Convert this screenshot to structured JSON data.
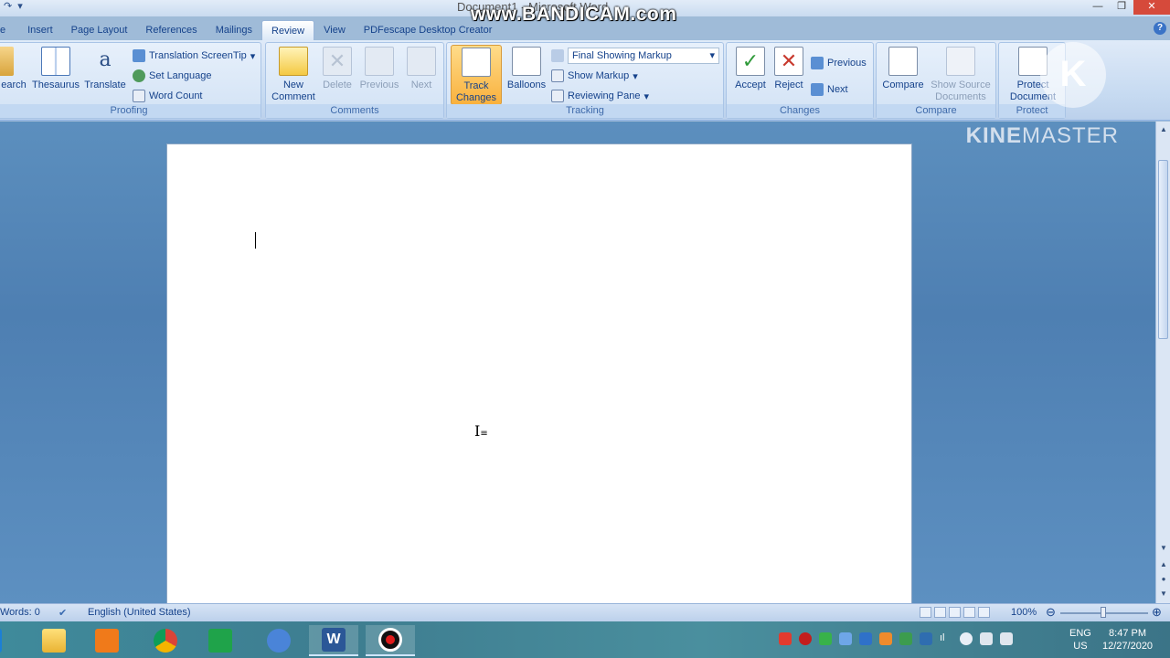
{
  "window": {
    "title": "Document1 - Microsoft Word",
    "watermark": "www.BANDICAM.com"
  },
  "tabs": [
    {
      "label": "e"
    },
    {
      "label": "Insert"
    },
    {
      "label": "Page Layout"
    },
    {
      "label": "References"
    },
    {
      "label": "Mailings"
    },
    {
      "label": "Review"
    },
    {
      "label": "View"
    },
    {
      "label": "PDFescape Desktop Creator"
    }
  ],
  "ribbon": {
    "proofing": {
      "label": "Proofing",
      "research": "earch",
      "thesaurus": "Thesaurus",
      "translate": "Translate",
      "translation_screentip": "Translation ScreenTip",
      "set_language": "Set Language",
      "word_count": "Word Count"
    },
    "comments": {
      "label": "Comments",
      "new_comment_1": "New",
      "new_comment_2": "Comment",
      "delete": "Delete",
      "previous": "Previous",
      "next": "Next"
    },
    "tracking": {
      "label": "Tracking",
      "track_changes_1": "Track",
      "track_changes_2": "Changes",
      "balloons": "Balloons",
      "display_for_review": "Final Showing Markup",
      "show_markup": "Show Markup",
      "reviewing_pane": "Reviewing Pane"
    },
    "changes": {
      "label": "Changes",
      "accept": "Accept",
      "reject": "Reject",
      "previous": "Previous",
      "next": "Next"
    },
    "compare": {
      "label": "Compare",
      "compare": "Compare",
      "show_source_1": "Show Source",
      "show_source_2": "Documents"
    },
    "protect": {
      "label": "Protect",
      "protect_1": "Protect",
      "protect_2": "Document"
    }
  },
  "overlay": {
    "kinemaster_1": "KINE",
    "kinemaster_2": "MASTER",
    "k_logo": "K"
  },
  "statusbar": {
    "words": "Words: 0",
    "language": "English (United States)",
    "zoom": "100%"
  },
  "taskbar": {
    "lang_1": "ENG",
    "lang_2": "US",
    "time": "8:47 PM",
    "date": "12/27/2020"
  },
  "colors": {
    "ribbon_accent": "#15428b",
    "track_changes_active": "#f9b13d",
    "doc_background": "#4e7fb2"
  }
}
